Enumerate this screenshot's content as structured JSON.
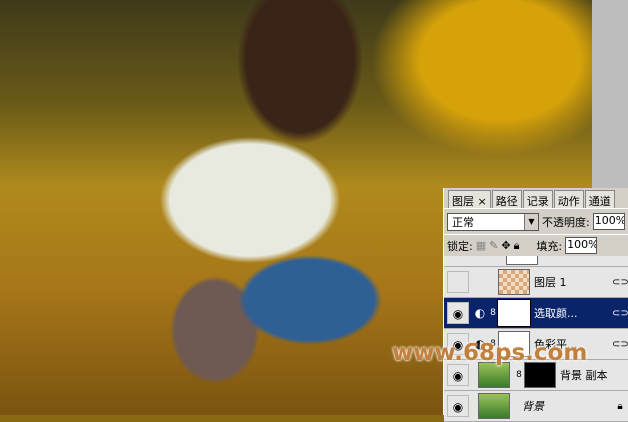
{
  "panel": {
    "tabs": [
      "图层",
      "路径",
      "记录",
      "动作",
      "通道"
    ],
    "tab_close": "×",
    "blend_mode": "正常",
    "opacity_label": "不透明度:",
    "opacity": "100%",
    "lock_label": "锁定:",
    "fill_label": "填充:",
    "fill": "100%",
    "layers": [
      {
        "name": "图层 1",
        "visible": false,
        "active": false
      },
      {
        "name": "选取颜...",
        "visible": true,
        "active": true
      },
      {
        "name": "色彩平...",
        "visible": true,
        "active": false
      },
      {
        "name": "背景 副本",
        "visible": true,
        "active": false
      },
      {
        "name": "背景",
        "visible": true,
        "active": false,
        "locked": true
      }
    ]
  },
  "watermark": "www.68ps.com"
}
